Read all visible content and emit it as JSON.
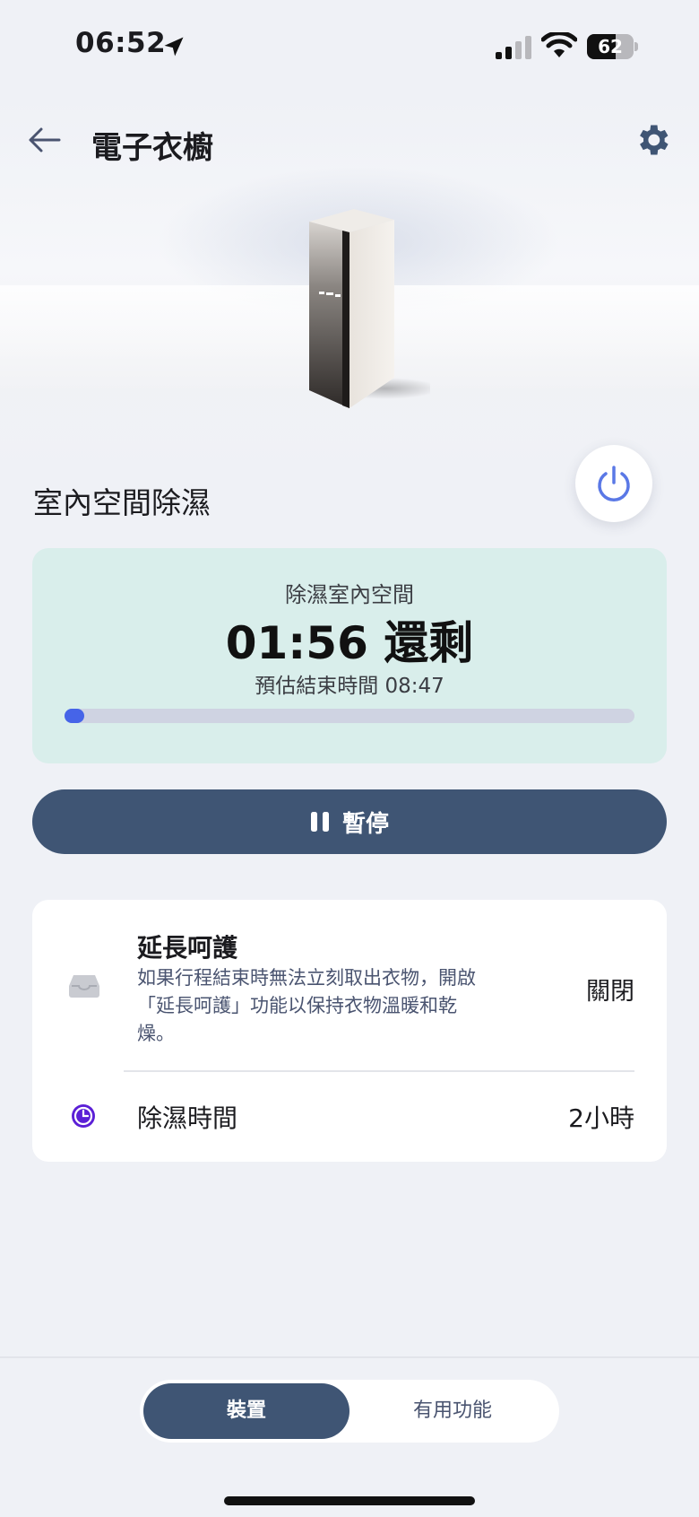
{
  "status_bar": {
    "time": "06:52",
    "battery_level": "62",
    "battery_fraction": 0.62
  },
  "header": {
    "title": "電子衣櫥",
    "back_icon": "back-arrow-icon",
    "settings_icon": "gear-icon"
  },
  "mode": {
    "title": "室內空間除濕",
    "power_icon": "power-icon"
  },
  "status_card": {
    "label": "除濕室內空間",
    "remaining": "01:56 還剩",
    "end_time": "預估結束時間 08:47",
    "progress_fraction": 0.02
  },
  "pause_button": {
    "label": "暫停",
    "icon": "pause-icon"
  },
  "settings": {
    "keep_warm": {
      "title": "延長呵護",
      "description": "如果行程結束時無法立刻取出衣物，開啟「延長呵護」功能以保持衣物溫暖和乾燥。",
      "value": "關閉",
      "icon": "tray-icon"
    },
    "duration": {
      "label": "除濕時間",
      "value": "2小時",
      "icon": "clock-icon"
    }
  },
  "tabs": [
    {
      "label": "裝置",
      "active": true
    },
    {
      "label": "有用功能",
      "active": false
    }
  ],
  "colors": {
    "accent": "#3f5574",
    "progress": "#4664e8",
    "status_card_bg": "#d9eeeb",
    "clock_icon": "#5b1fd6"
  }
}
